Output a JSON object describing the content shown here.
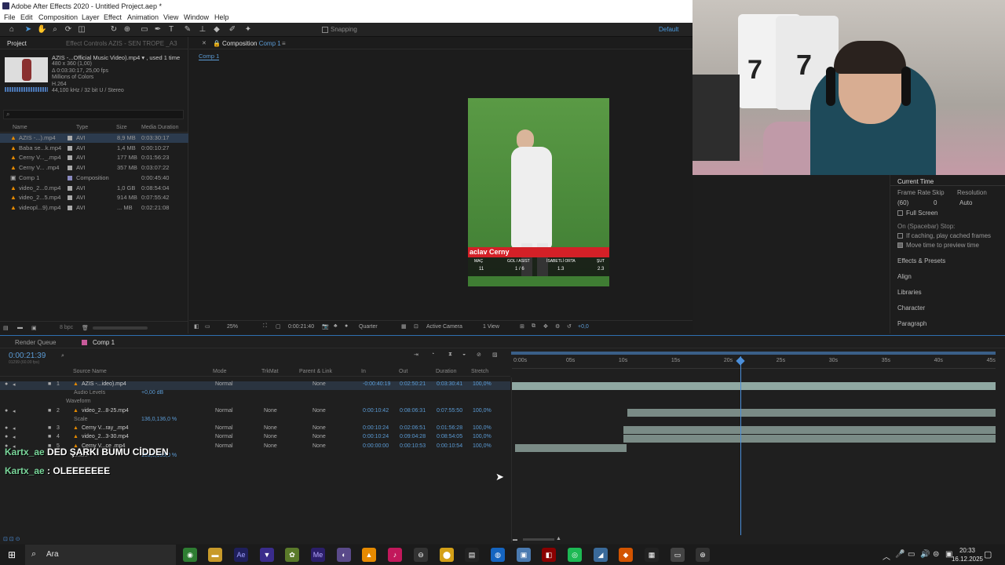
{
  "title": "Adobe After Effects 2020 - Untitled Project.aep *",
  "menu": [
    "File",
    "Edit",
    "Composition",
    "Layer",
    "Effect",
    "Animation",
    "View",
    "Window",
    "Help"
  ],
  "toolbar": {
    "snapping": "Snapping",
    "workspace": "Default"
  },
  "project": {
    "tab": "Project",
    "effect_tab": "Effect Controls AZIS - SEN TROPE _A3",
    "file_name": "AZIS -...Official Music Video).mp4 ▾ , used 1 time",
    "info": [
      "480 x 360 (1,00)",
      "Δ 0:03:30:17, 25,00 fps",
      "Millions of Colors",
      "H.264",
      "44,100 kHz / 32 bit U / Stereo"
    ],
    "search_placeholder": "",
    "columns": {
      "name": "Name",
      "type": "Type",
      "size": "Size",
      "duration": "Media Duration"
    },
    "items": [
      {
        "name": "AZIS -...).mp4",
        "type": "AVI",
        "size": "8,9 MB",
        "duration": "0:03:30:17",
        "icon": "vlc-cone-icon"
      },
      {
        "name": "Baba se...k.mp4",
        "type": "AVI",
        "size": "1,4 MB",
        "duration": "0:00:10:27",
        "icon": "vlc-cone-icon"
      },
      {
        "name": "Cerny V..._.mp4",
        "type": "AVI",
        "size": "177 MB",
        "duration": "0:01:56:23",
        "icon": "vlc-cone-icon"
      },
      {
        "name": "Cerny V... .mp4",
        "type": "AVI",
        "size": "357 MB",
        "duration": "0:03:07:22",
        "icon": "vlc-cone-icon"
      },
      {
        "name": "Comp 1",
        "type": "Composition",
        "size": "",
        "duration": "0:00:45:40",
        "icon": "composition-icon"
      },
      {
        "name": "video_2...0.mp4",
        "type": "AVI",
        "size": "1,0 GB",
        "duration": "0:08:54:04",
        "icon": "vlc-cone-icon"
      },
      {
        "name": "video_2...5.mp4",
        "type": "AVI",
        "size": "914 MB",
        "duration": "0:07:55:42",
        "icon": "vlc-cone-icon"
      },
      {
        "name": "videopl...9).mp4",
        "type": "AVI",
        "size": "... MB",
        "duration": "0:02:21:08",
        "icon": "vlc-cone-icon"
      }
    ],
    "bpc": "8 bpc"
  },
  "viewer": {
    "tab": "Composition",
    "tab_comp": "Comp 1",
    "breadcrumb": "Comp 1",
    "zoom": "25%",
    "timecode": "0:00:21:40",
    "quality": "Quarter",
    "camera": "Active Camera",
    "views": "1 View",
    "exposure": "+0,0",
    "overlay_name": "aclav Cerny",
    "stats_headers": [
      "MAÇ",
      "GOL / ASIST",
      "İSABETLİ ORTA",
      "ŞUT"
    ],
    "stats_values": [
      "11",
      "1 / 6",
      "1.3",
      "2.3"
    ]
  },
  "right_panel": {
    "header": "Current Time",
    "frame_rate_label": "Frame Rate",
    "skip_label": "Skip",
    "resolution_label": "Resolution",
    "frame_rate": "(60)",
    "skip": "0",
    "resolution": "Auto",
    "full_screen": "Full Screen",
    "on_spacebar": "On (Spacebar) Stop:",
    "if_caching": "If caching, play cached frames",
    "move_time": "Move time to preview time",
    "sections": [
      "Effects & Presets",
      "Align",
      "Libraries",
      "Character",
      "Paragraph"
    ]
  },
  "timeline": {
    "render_queue": "Render Queue",
    "comp_tab": "Comp 1",
    "current_time": "0:00:21:39",
    "frame_sub": "01299 (60.00 fps)",
    "columns": {
      "source": "Source Name",
      "mode": "Mode",
      "trkmat": "TrkMat",
      "parent": "Parent & Link",
      "in": "In",
      "out": "Out",
      "duration": "Duration",
      "stretch": "Stretch"
    },
    "ruler": [
      "0:00s",
      "05s",
      "10s",
      "15s",
      "20s",
      "25s",
      "30s",
      "35s",
      "40s",
      "45s"
    ],
    "layers": [
      {
        "num": "1",
        "name": "AZIS -...ideo).mp4",
        "mode": "Normal",
        "trkmat": "",
        "parent": "None",
        "in": "-0:00:40:19",
        "out": "0:02:50:21",
        "duration": "0:03:30:41",
        "stretch": "100,0%",
        "bar_start": 0,
        "bar_end": 1
      },
      {
        "num": "2",
        "name": "video_2...8-25.mp4",
        "mode": "Normal",
        "trkmat": "None",
        "parent": "None",
        "in": "0:00:10:42",
        "out": "0:08:06:31",
        "duration": "0:07:55:50",
        "stretch": "100,0%",
        "bar_start": 0.238,
        "bar_end": 1
      },
      {
        "num": "3",
        "name": "Cerny V...ray_.mp4",
        "mode": "Normal",
        "trkmat": "None",
        "parent": "None",
        "in": "0:00:10:24",
        "out": "0:02:06:51",
        "duration": "0:01:56:28",
        "stretch": "100,0%",
        "bar_start": 0.231,
        "bar_end": 1
      },
      {
        "num": "4",
        "name": "video_2...3-30.mp4",
        "mode": "Normal",
        "trkmat": "None",
        "parent": "None",
        "in": "0:00:10:24",
        "out": "0:09:04:28",
        "duration": "0:08:54:05",
        "stretch": "100,0%",
        "bar_start": 0.231,
        "bar_end": 1
      },
      {
        "num": "5",
        "name": "Cerny V...ce .mp4",
        "mode": "Normal",
        "trkmat": "None",
        "parent": "None",
        "in": "0:00:00:00",
        "out": "0:00:10:53",
        "duration": "0:00:10:54",
        "stretch": "100,0%",
        "bar_start": 0.006,
        "bar_end": 0.237
      }
    ],
    "sub_audio": "Audio Levels",
    "sub_audio_val": "+0,00 dB",
    "sub_waveform": "Waveform",
    "sub_scale": "Scale",
    "scale_val_2": "136,0,136,0 %",
    "scale_val_5": "158,0,158,0 %",
    "playhead_fraction": 0.473
  },
  "chat": [
    {
      "user": "Kartx_ae",
      "msg": "DED ŞARKI BUMU CİDDEN"
    },
    {
      "user": "Kartx_ae",
      "msg": ": OLEEEEEEE"
    }
  ],
  "taskbar": {
    "search": "Ara",
    "time": "20:33",
    "date": "16.12.2025"
  }
}
